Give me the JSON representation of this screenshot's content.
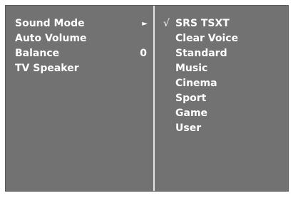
{
  "left_menu": {
    "items": [
      {
        "label": "Sound Mode",
        "arrow": "►",
        "value": ""
      },
      {
        "label": "Auto Volume",
        "arrow": "",
        "value": ""
      },
      {
        "label": "Balance",
        "arrow": "",
        "value": "0"
      },
      {
        "label": "TV Speaker",
        "arrow": "",
        "value": ""
      }
    ]
  },
  "right_menu": {
    "check_mark": "√",
    "selected_index": 0,
    "options": [
      {
        "label": "SRS  TSXT"
      },
      {
        "label": "Clear Voice"
      },
      {
        "label": "Standard"
      },
      {
        "label": "Music"
      },
      {
        "label": "Cinema"
      },
      {
        "label": "Sport"
      },
      {
        "label": "Game"
      },
      {
        "label": "User"
      }
    ]
  },
  "colors": {
    "panel_background": "#727272",
    "divider": "#e4e4e4",
    "text": "#ffffff"
  }
}
